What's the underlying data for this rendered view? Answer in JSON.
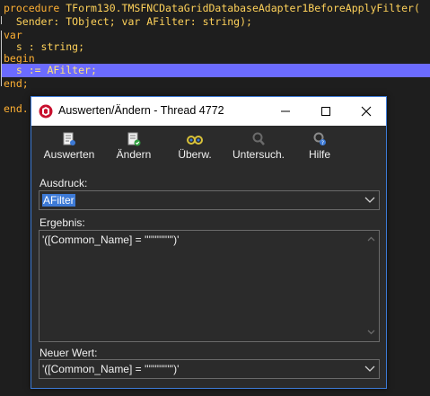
{
  "editor": {
    "lines": [
      {
        "prefix": "procedure ",
        "rest": "TForm130.TMSFNCDataGridDatabaseAdapter1BeforeApplyFilter("
      },
      {
        "prefix": "  ",
        "rest": "Sender: TObject; var AFilter: string);"
      },
      {
        "prefix": "var",
        "rest": ""
      },
      {
        "prefix": "  ",
        "rest": "s : string;"
      },
      {
        "prefix": "begin",
        "rest": ""
      },
      {
        "prefix": "  ",
        "rest": "s := AFilter;"
      },
      {
        "prefix": "end;",
        "rest": ""
      },
      {
        "prefix": "",
        "rest": ""
      },
      {
        "prefix": "end.",
        "rest": ""
      }
    ],
    "highlight_color": "#6b6bff"
  },
  "dialog": {
    "title": "Auswerten/Ändern - Thread 4772",
    "accent": "#3d7ad6",
    "toolbar": [
      {
        "label": "Auswerten",
        "icon": "evaluate-icon"
      },
      {
        "label": "Ändern",
        "icon": "modify-icon"
      },
      {
        "label": "Überw.",
        "icon": "watch-icon"
      },
      {
        "label": "Untersuch.",
        "icon": "inspect-icon"
      },
      {
        "label": "Hilfe",
        "icon": "help-icon"
      }
    ],
    "expression_label": "Ausdruck:",
    "expression_value": "AFilter",
    "result_label": "Ergebnis:",
    "result_value": "'([Common_Name] = '''''''''''''')'",
    "new_value_label": "Neuer Wert:",
    "new_value_value": "'([Common_Name] = '''''''''''''')'"
  }
}
